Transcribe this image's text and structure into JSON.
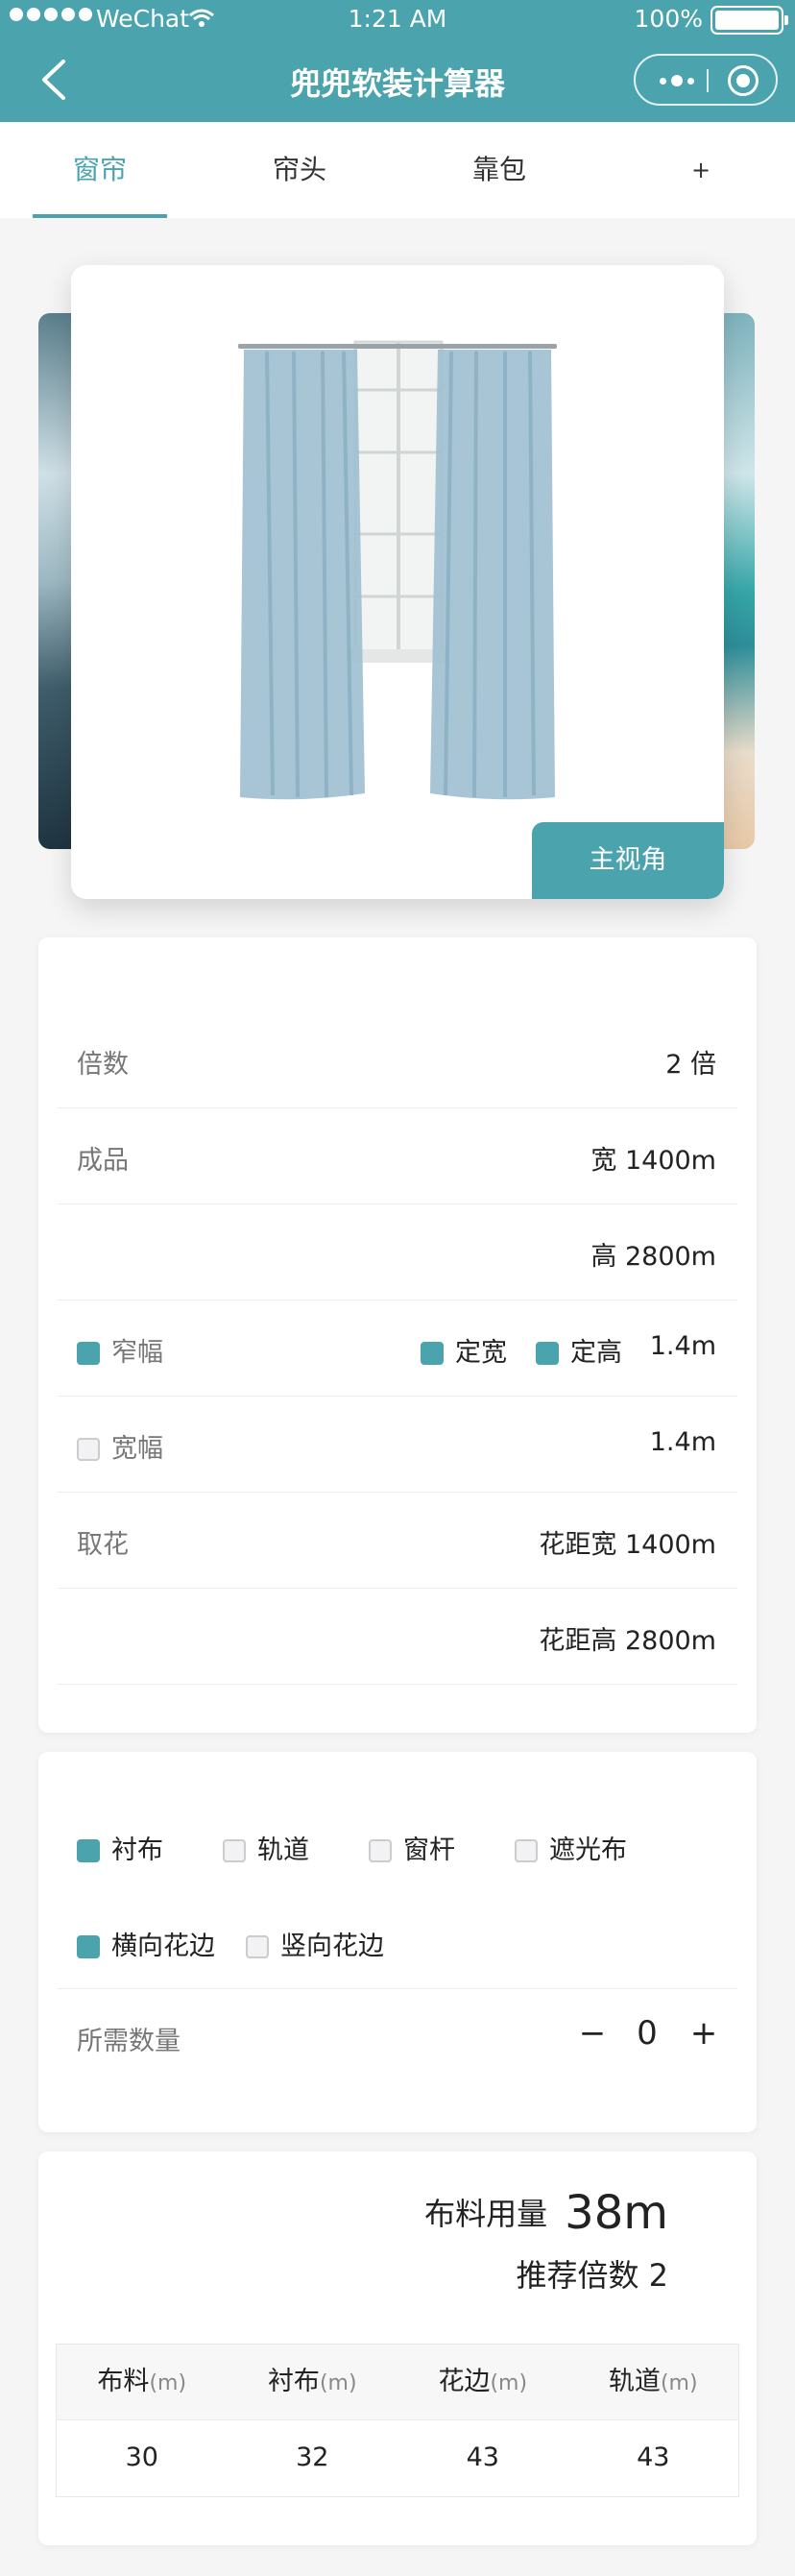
{
  "status_bar": {
    "carrier": "WeChat",
    "time": "1:21 AM",
    "battery": "100%"
  },
  "nav": {
    "title": "兜兜软装计算器"
  },
  "tabs": [
    {
      "label": "窗帘"
    },
    {
      "label": "帘头"
    },
    {
      "label": "靠包"
    },
    {
      "label": "+"
    }
  ],
  "gallery": {
    "view_button": "主视角"
  },
  "size_panel": {
    "multiple": {
      "label": "倍数",
      "value": "2 倍"
    },
    "finished": {
      "label": "成品",
      "width": "宽 1400m",
      "height": "高 2800m"
    },
    "narrow": {
      "label": "窄幅",
      "fixed_width": "定宽",
      "fixed_height": "定高",
      "value": "1.4m"
    },
    "wide": {
      "label": "宽幅",
      "value": "1.4m"
    },
    "pattern": {
      "label": "取花",
      "width": "花距宽 1400m",
      "height": "花距高 2800m"
    }
  },
  "options_panel": {
    "options": [
      {
        "label": "衬布",
        "checked": true
      },
      {
        "label": "轨道",
        "checked": false
      },
      {
        "label": "窗杆",
        "checked": false
      },
      {
        "label": "遮光布",
        "checked": false
      },
      {
        "label": "横向花边",
        "checked": true
      },
      {
        "label": "竖向花边",
        "checked": false
      }
    ],
    "quantity": {
      "label": "所需数量",
      "minus": "−",
      "value": "0",
      "plus": "+"
    }
  },
  "result_panel": {
    "usage_label": "布料用量",
    "usage_value": "38m",
    "ratio_text": "推荐倍数 2",
    "table": {
      "columns": [
        {
          "name": "布料",
          "unit": "(m)"
        },
        {
          "name": "衬布",
          "unit": "(m)"
        },
        {
          "name": "花边",
          "unit": "(m)"
        },
        {
          "name": "轨道",
          "unit": "(m)"
        }
      ],
      "rows": [
        [
          "30",
          "32",
          "43",
          "43"
        ]
      ]
    }
  },
  "colors": {
    "accent": "#4aa3ad",
    "background": "#f5f5f5"
  }
}
